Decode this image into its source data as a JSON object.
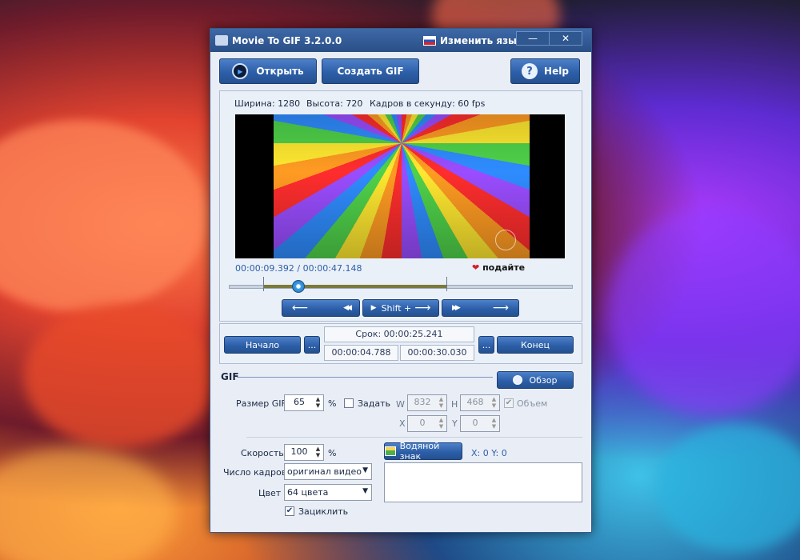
{
  "window": {
    "title": "Movie To GIF 3.2.0.0",
    "language_label": "Изменить язык",
    "minimize_glyph": "—",
    "close_glyph": "✕"
  },
  "toolbar": {
    "open_label": "Открыть",
    "create_gif_label": "Создать GIF",
    "help_label": "Help"
  },
  "video_info": {
    "width": "Ширина: 1280",
    "height": "Высота: 720",
    "fps": "Кадров в секунду: 60 fps"
  },
  "playback": {
    "time": "00:00:09.392 / 00:00:47.148",
    "donate": "подайте",
    "progress_fraction": 0.199,
    "back_arrow": "⟵",
    "rewind": "◀◀",
    "shift_label": "Shift +",
    "forward": "▶▶",
    "fwd_arrow": "⟶"
  },
  "range": {
    "start_label": "Начало",
    "end_label": "Конец",
    "browse": "...",
    "duration": "Срок: 00:00:25.241",
    "start_time": "00:00:04.788",
    "end_time": "00:00:30.030"
  },
  "gif": {
    "section_label": "GIF",
    "browse_label": "Обзор",
    "size_label": "Размер GIF",
    "size_value": "65",
    "percent": "%",
    "set_label": "Задать",
    "w_label": "W",
    "w_value": "832",
    "h_label": "H",
    "h_value": "468",
    "volume_label": "Объем",
    "x_label": "X",
    "x_value": "0",
    "y_label": "Y",
    "y_value": "0",
    "speed_label": "Скорость",
    "speed_value": "100",
    "frames_label": "Число кадров",
    "frames_value": "оригинал видео",
    "color_label": "Цвет",
    "color_value": "64 цвета",
    "loop_label": "Зациклить",
    "watermark_label": "Водяной знак",
    "watermark_coords": "X: 0  Y: 0",
    "check": "✔"
  }
}
